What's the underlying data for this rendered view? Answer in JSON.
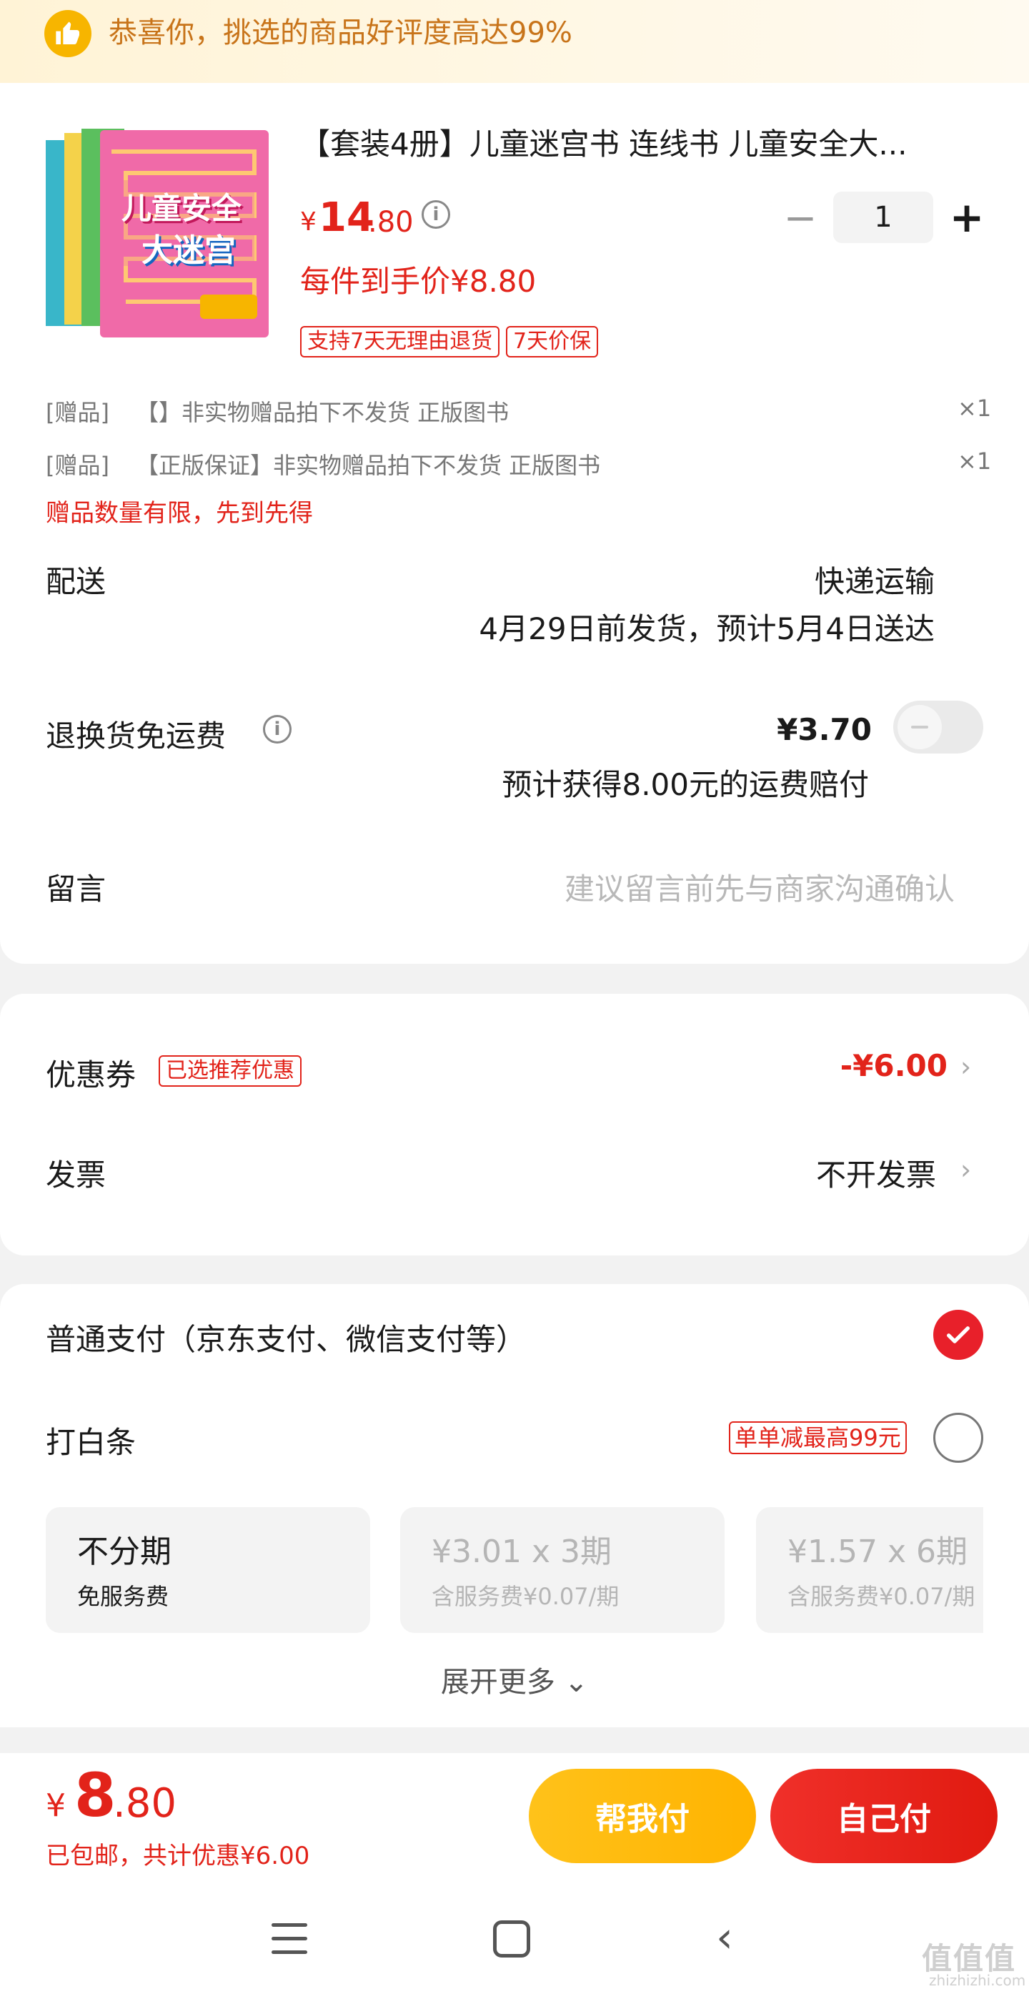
{
  "banner": {
    "text": "恭喜你，挑选的商品好评度高达99%",
    "icon": "thumbs-up-icon"
  },
  "product": {
    "title": "【套装4册】儿童迷宫书 连线书 儿童安全大...",
    "cover_title_line1": "儿童安全",
    "cover_title_line2": "大迷宫",
    "price_symbol": "¥",
    "price_int": "14",
    "price_dec": ".80",
    "unit_price": "每件到手价¥8.80",
    "tags": [
      "支持7天无理由退货",
      "7天价保"
    ],
    "quantity": "1",
    "qty_minus": "−",
    "qty_plus": "+"
  },
  "gifts": [
    {
      "label": "[赠品]",
      "text": "【】非实物赠品拍下不发货 正版图书",
      "count": "×1"
    },
    {
      "label": "[赠品]",
      "text": "【正版保证】非实物赠品拍下不发货 正版图书",
      "count": "×1"
    }
  ],
  "gift_note": "赠品数量有限，先到先得",
  "delivery": {
    "label": "配送",
    "method": "快递运输",
    "date": "4月29日前发货，预计5月4日送达"
  },
  "return_shipping": {
    "label": "退换货免运费",
    "price": "¥3.70",
    "toggle_on": false,
    "compensation": "预计获得8.00元的运费赔付"
  },
  "message": {
    "label": "留言",
    "placeholder": "建议留言前先与商家沟通确认"
  },
  "coupon": {
    "label": "优惠券",
    "tag": "已选推荐优惠",
    "amount": "-¥6.00",
    "chevron": "›"
  },
  "invoice": {
    "label": "发票",
    "value": "不开发票",
    "chevron": "›"
  },
  "payment": {
    "normal": {
      "label": "普通支付（京东支付、微信支付等）",
      "selected": true
    },
    "baitiao": {
      "label": "打白条",
      "tag": "单单减最高99元",
      "selected": false
    },
    "installments": [
      {
        "main": "不分期",
        "sub": "免服务费",
        "active": true
      },
      {
        "main": "¥3.01 x 3期",
        "sub": "含服务费¥0.07/期",
        "active": false
      },
      {
        "main": "¥1.57 x 6期",
        "sub": "含服务费¥0.07/期",
        "active": false
      }
    ],
    "expand_more": "展开更多 ⌄"
  },
  "bottom": {
    "total_symbol": "¥",
    "total_int": "8",
    "total_dec": ".80",
    "note": "已包邮，共计优惠¥6.00",
    "help_pay": "帮我付",
    "self_pay": "自己付"
  },
  "nav": {
    "back": "‹"
  },
  "watermark": {
    "text": "值值值",
    "sub": "zhizhizhi.com"
  },
  "colors": {
    "accent": "#e2231a",
    "banner_text": "#c8741a",
    "help_button": "#ffb300"
  }
}
